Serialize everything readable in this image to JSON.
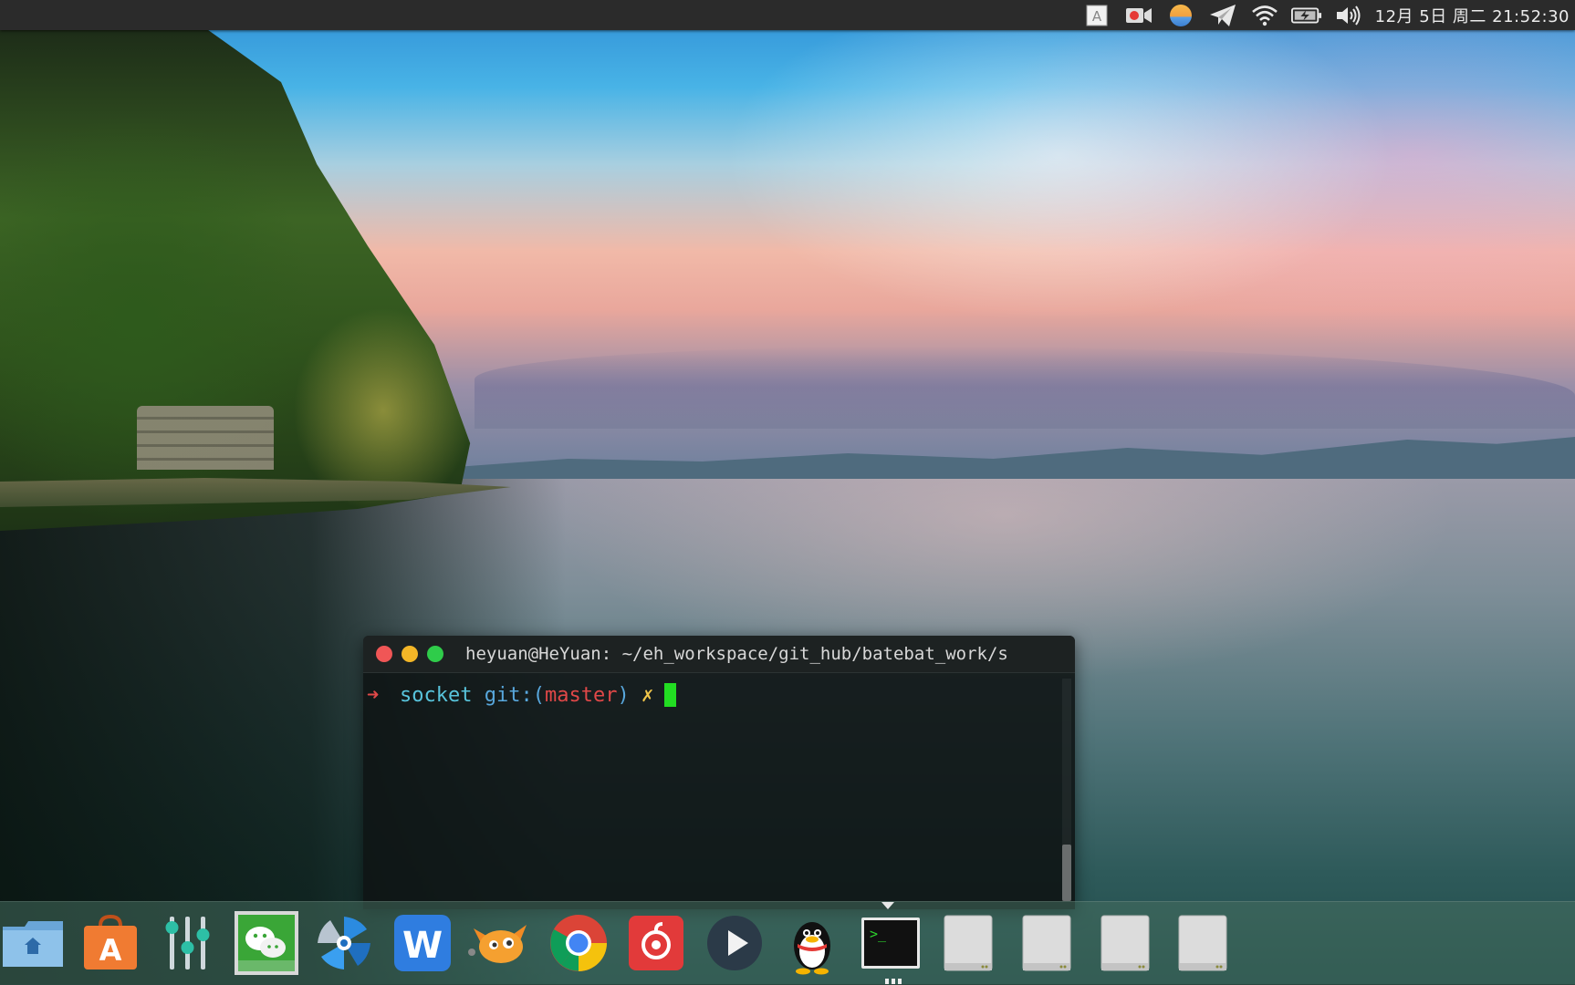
{
  "top_panel": {
    "tray_icons": [
      "input-method-icon",
      "screen-recorder-icon",
      "color-picker-icon",
      "telegram-icon",
      "wifi-icon",
      "battery-icon",
      "volume-icon"
    ],
    "input_method_label": "A",
    "clock": "12月 5日 周二 21:52:30"
  },
  "terminal": {
    "title": "heyuan@HeYuan: ~/eh_workspace/git_hub/batebat_work/s",
    "prompt": {
      "arrow": "➜",
      "directory": "socket",
      "git_prefix": "git:(",
      "branch": "master",
      "git_suffix": ")",
      "dirty_mark": "✗"
    },
    "colors": {
      "close": "#f05656",
      "minimize": "#f3b627",
      "maximize": "#2fcc4a",
      "cursor": "#22dd22"
    }
  },
  "dock": {
    "items": [
      {
        "name": "files",
        "icon": "folder-home-icon"
      },
      {
        "name": "software-center",
        "icon": "app-store-icon"
      },
      {
        "name": "settings-mixer",
        "icon": "sliders-icon"
      },
      {
        "name": "wechat",
        "icon": "wechat-icon"
      },
      {
        "name": "deepin-screenshot",
        "icon": "blue-swirl-icon"
      },
      {
        "name": "wps-writer",
        "icon": "wps-w-icon"
      },
      {
        "name": "fox-app",
        "icon": "fox-icon"
      },
      {
        "name": "chrome",
        "icon": "chrome-icon"
      },
      {
        "name": "netease-music",
        "icon": "netease-music-icon"
      },
      {
        "name": "media-player",
        "icon": "play-icon"
      },
      {
        "name": "qq",
        "icon": "qq-penguin-icon"
      },
      {
        "name": "terminal",
        "icon": "terminal-icon"
      },
      {
        "name": "drive-1",
        "icon": "drive-icon"
      },
      {
        "name": "drive-2",
        "icon": "drive-icon"
      },
      {
        "name": "drive-3",
        "icon": "drive-icon"
      },
      {
        "name": "drive-4",
        "icon": "drive-icon"
      }
    ]
  }
}
